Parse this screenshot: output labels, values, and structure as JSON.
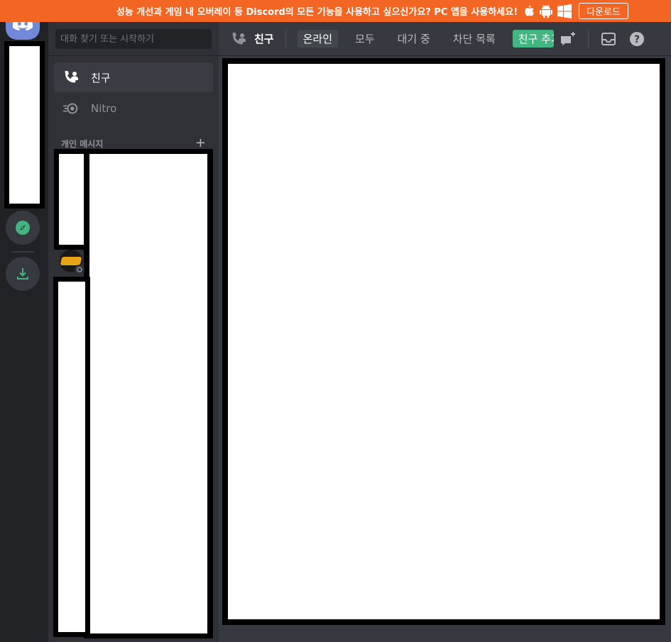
{
  "banner": {
    "text": "성능 개선과 게임 내 오버레이 등 Discord의 모든 기능을 사용하고 싶으신가요? PC 앱을 사용하세요!",
    "download_label": "다운로드",
    "platform_icons": [
      "apple-icon",
      "android-icon",
      "windows-icon"
    ]
  },
  "rail": {
    "home_icon": "discord-logo-icon",
    "explore_icon": "compass-icon",
    "download_icon": "download-icon"
  },
  "sidebar": {
    "search_placeholder": "대화 찾기 또는 시작하기",
    "nav": [
      {
        "label": "친구",
        "icon": "friends-icon"
      },
      {
        "label": "Nitro",
        "icon": "nitro-icon"
      }
    ],
    "dm_header": "개인 메시지",
    "dm_add": "+"
  },
  "topbar": {
    "title": "친구",
    "tabs": [
      {
        "label": "온라인",
        "active": true
      },
      {
        "label": "모두",
        "active": false
      },
      {
        "label": "대기 중",
        "active": false
      },
      {
        "label": "차단 목록",
        "active": false
      }
    ],
    "add_friend_label": "친구 추가하기",
    "icons": [
      "new-group-dm-icon",
      "inbox-icon",
      "help-icon"
    ]
  },
  "colors": {
    "banner": "#f26522",
    "blurple": "#7289da",
    "green": "#43b581",
    "rail": "#202225",
    "sidebar": "#2f3136",
    "main": "#36393f"
  }
}
